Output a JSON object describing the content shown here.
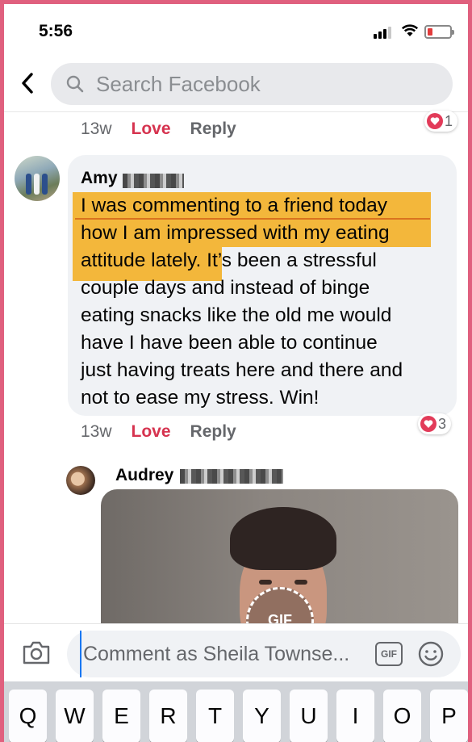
{
  "status_bar": {
    "time": "5:56"
  },
  "search": {
    "placeholder": "Search Facebook"
  },
  "previous_comment": {
    "age": "13w",
    "love_label": "Love",
    "reply_label": "Reply",
    "reaction_count": "1"
  },
  "amy_comment": {
    "author": "Amy",
    "highlighted_lines": [
      "I was commenting to a friend today",
      "how I am impressed with my eating",
      "attitude lately."
    ],
    "text_lines": [
      "I was commenting to a friend today",
      "how I am impressed with my eating",
      "attitude lately. It’s been a stressful",
      "couple days and instead of binge",
      "eating snacks like the old me would",
      "have I have been able to continue",
      "just having treats here and there and",
      "not to ease my stress. Win!"
    ],
    "age": "13w",
    "love_label": "Love",
    "reply_label": "Reply",
    "reaction_count": "3"
  },
  "audrey_reply": {
    "author": "Audrey",
    "gif_label": "GIF"
  },
  "composer": {
    "placeholder": "Comment as Sheila Townse...",
    "gif_button": "GIF"
  },
  "keyboard": {
    "keys": [
      "Q",
      "W",
      "E",
      "R",
      "T",
      "Y",
      "U",
      "I",
      "O",
      "P"
    ]
  },
  "colors": {
    "frame_border": "#e0607e",
    "love": "#d6334f",
    "highlight": "#f3b73b",
    "bubble": "#f0f2f5"
  }
}
